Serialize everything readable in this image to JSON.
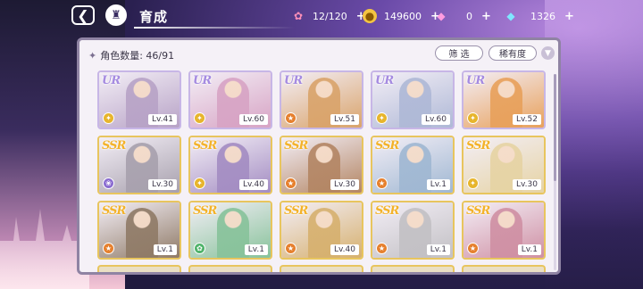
{
  "topbar": {
    "title": "育成",
    "back_icon": "back-arrow-icon",
    "home_icon": "castle-home-icon"
  },
  "resources": [
    {
      "id": "stamina",
      "icon": "candy-icon",
      "value": "12/120"
    },
    {
      "id": "gold",
      "icon": "coin-icon",
      "value": "149600"
    },
    {
      "id": "gem-pink",
      "icon": "pink-diamond-icon",
      "value": "0"
    },
    {
      "id": "gem-blue",
      "icon": "blue-diamond-icon",
      "value": "1326"
    }
  ],
  "panel": {
    "count_label": "角色数量: 46/91",
    "filter_label": "筛 选",
    "rarity_label": "稀有度"
  },
  "cards": [
    {
      "rarity": "UR",
      "level": "Lv.41",
      "role": "yellow",
      "art": "#b7a2c6"
    },
    {
      "rarity": "UR",
      "level": "Lv.60",
      "role": "yellow",
      "art": "#d7a3c4"
    },
    {
      "rarity": "UR",
      "level": "Lv.51",
      "role": "orange",
      "art": "#d9a36a"
    },
    {
      "rarity": "UR",
      "level": "Lv.60",
      "role": "yellow",
      "art": "#aeb8d6"
    },
    {
      "rarity": "UR",
      "level": "Lv.52",
      "role": "yellow",
      "art": "#e8a05a"
    },
    {
      "rarity": "SSR",
      "level": "Lv.30",
      "role": "purple",
      "art": "#a7a0ad"
    },
    {
      "rarity": "SSR",
      "level": "Lv.40",
      "role": "yellow",
      "art": "#a38cc2"
    },
    {
      "rarity": "SSR",
      "level": "Lv.30",
      "role": "orange",
      "art": "#b38563"
    },
    {
      "rarity": "SSR",
      "level": "Lv.1",
      "role": "orange",
      "art": "#9fb7d2"
    },
    {
      "rarity": "SSR",
      "level": "Lv.30",
      "role": "yellow",
      "art": "#e6d3a3"
    },
    {
      "rarity": "SSR",
      "level": "Lv.1",
      "role": "orange",
      "art": "#8f7a66"
    },
    {
      "rarity": "SSR",
      "level": "Lv.1",
      "role": "green",
      "art": "#87c29a"
    },
    {
      "rarity": "SSR",
      "level": "Lv.40",
      "role": "orange",
      "art": "#d6b06e"
    },
    {
      "rarity": "SSR",
      "level": "Lv.1",
      "role": "orange",
      "art": "#c2c0c4"
    },
    {
      "rarity": "SSR",
      "level": "Lv.1",
      "role": "orange",
      "art": "#cf8fa3"
    }
  ],
  "colors": {
    "role_yellow": "#e7b52c",
    "role_orange": "#e6802e",
    "role_purple": "#8a6cd0",
    "role_green": "#4fb36a"
  }
}
